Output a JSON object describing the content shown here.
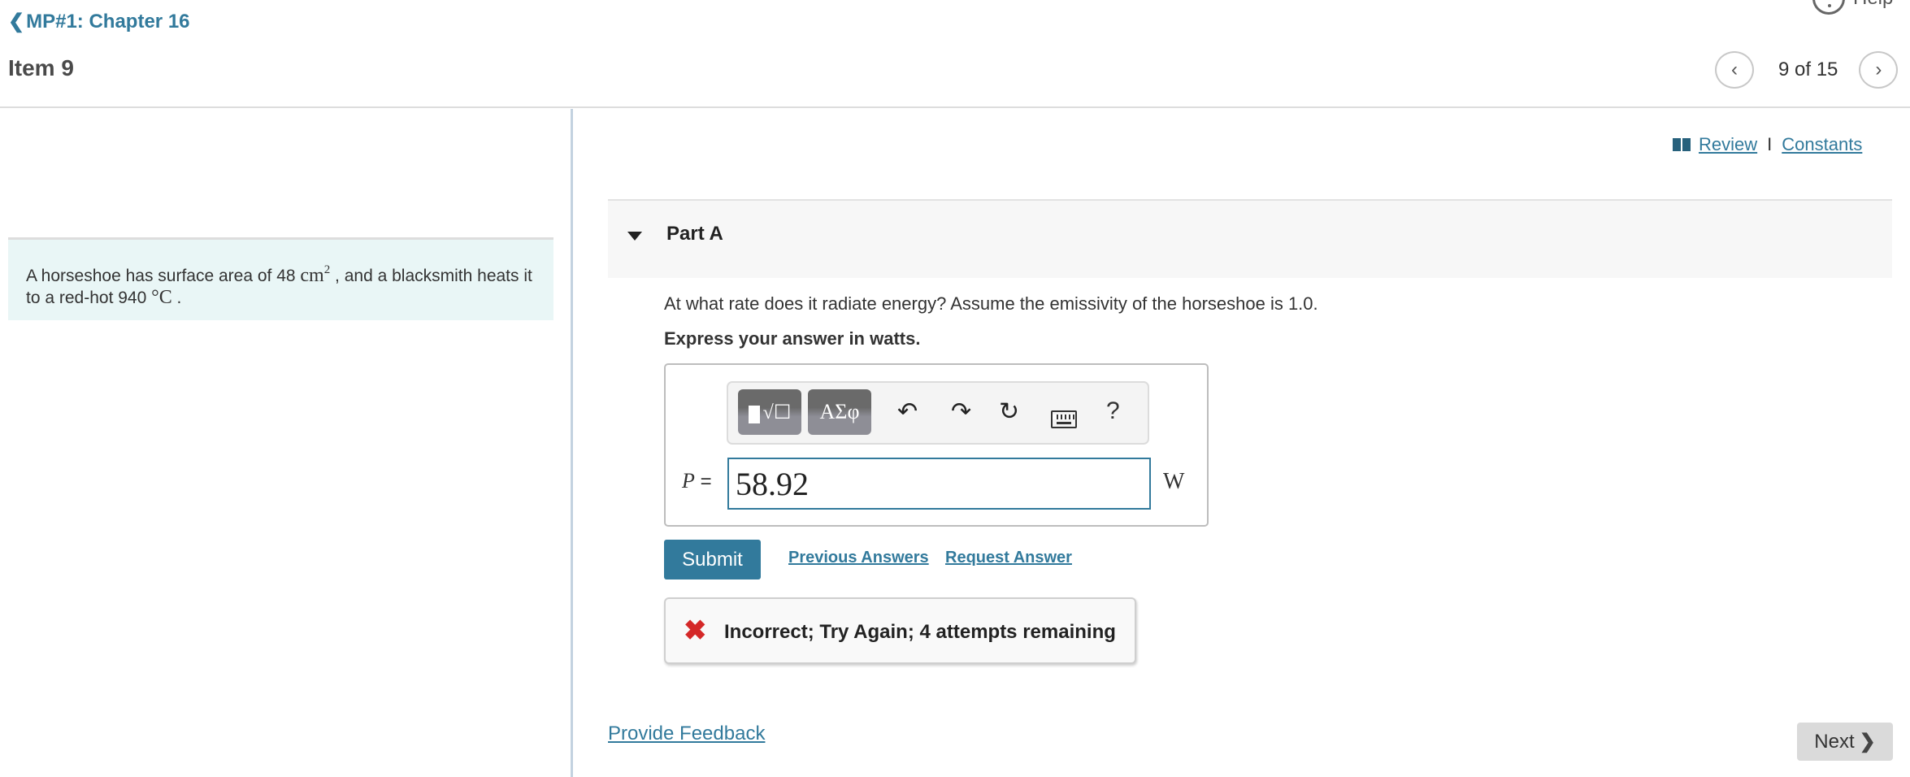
{
  "header": {
    "breadcrumb": "MP#1: Chapter 16",
    "item_title": "Item 9",
    "help_label": "Help",
    "pager": {
      "text": "9 of 15",
      "current": 9,
      "total": 15
    }
  },
  "problem": {
    "text_part1": "A horseshoe has surface area of 48 ",
    "area_unit": "cm",
    "area_exp": "2",
    "text_part2": " , and a blacksmith heats it to a red-hot 940 ",
    "temp_unit": "°C",
    "text_part3": " ."
  },
  "resources": {
    "review": "Review",
    "separator": "I",
    "constants": "Constants"
  },
  "part": {
    "title": "Part A",
    "question": "At what rate does it radiate energy? Assume the emissivity of the horseshoe is 1.0.",
    "instruction": "Express your answer in watts.",
    "toolbar": {
      "greek_label": "ΑΣφ",
      "help_label": "?"
    },
    "variable": "P",
    "equals": "=",
    "answer_value": "58.92",
    "unit": "W",
    "submit_label": "Submit",
    "previous_answers": "Previous Answers",
    "request_answer": "Request Answer",
    "feedback": "Incorrect; Try Again; 4 attempts remaining",
    "attempts_remaining": 4
  },
  "footer": {
    "provide_feedback": "Provide Feedback",
    "next_label": "Next"
  },
  "colors": {
    "accent": "#327a9c",
    "error": "#d42828",
    "problem_bg": "#e9f6f6"
  }
}
